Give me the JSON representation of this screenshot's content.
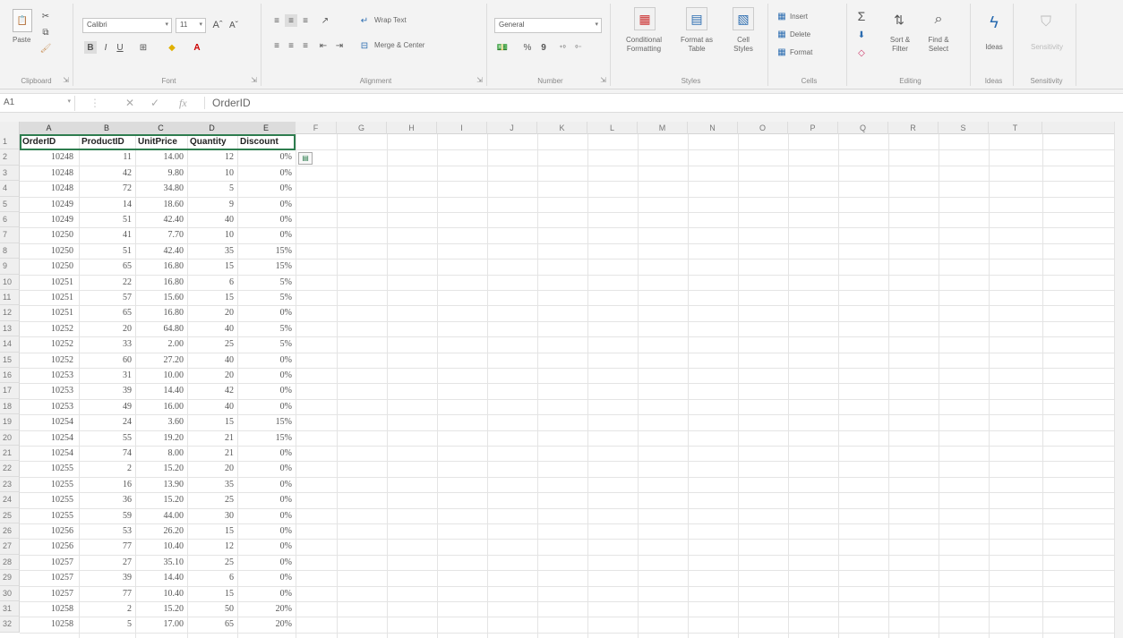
{
  "ribbon": {
    "clipboard": {
      "paste": "Paste",
      "label": "Clipboard"
    },
    "font": {
      "name": "Calibri",
      "size": "11",
      "grow": "Aˆ",
      "shrink": "Aˇ",
      "bold": "B",
      "italic": "I",
      "underline": "U",
      "label": "Font"
    },
    "alignment": {
      "wrap": "Wrap Text",
      "merge": "Merge & Center",
      "label": "Alignment"
    },
    "number": {
      "format": "General",
      "percent": "%",
      "comma": "9",
      "label": "Number"
    },
    "styles": {
      "conditional": "Conditional",
      "conditional2": "Formatting",
      "format_table": "Format as",
      "format_table2": "Table",
      "cell_styles": "Cell",
      "cell_styles2": "Styles",
      "label": "Styles"
    },
    "cells": {
      "insert": "Insert",
      "delete": "Delete",
      "format": "Format",
      "label": "Cells"
    },
    "editing": {
      "sort": "Sort &",
      "sort2": "Filter",
      "find": "Find &",
      "find2": "Select",
      "label": "Editing"
    },
    "ideas": {
      "btn": "Ideas",
      "label": "Ideas"
    },
    "sensitivity": {
      "btn": "Sensitivity",
      "label": "Sensitivity"
    }
  },
  "formula_bar": {
    "name_box": "A1",
    "fx": "fx",
    "content": "OrderID"
  },
  "grid": {
    "columns": [
      "A",
      "B",
      "C",
      "D",
      "E",
      "F",
      "G",
      "H",
      "I",
      "J",
      "K",
      "L",
      "M",
      "N",
      "O",
      "P",
      "Q",
      "R",
      "S",
      "T"
    ],
    "row_numbers": [
      "1",
      "2",
      "3",
      "4",
      "5",
      "6",
      "7",
      "8",
      "9",
      "10",
      "11",
      "12",
      "13",
      "14",
      "15",
      "16",
      "17",
      "18",
      "19",
      "20",
      "21",
      "22",
      "23",
      "24",
      "25",
      "26",
      "27",
      "28",
      "29",
      "30",
      "31",
      "32"
    ],
    "headers": [
      "OrderID",
      "ProductID",
      "UnitPrice",
      "Quantity",
      "Discount"
    ],
    "rows": [
      [
        "10248",
        "11",
        "14.00",
        "12",
        "0%"
      ],
      [
        "10248",
        "42",
        "9.80",
        "10",
        "0%"
      ],
      [
        "10248",
        "72",
        "34.80",
        "5",
        "0%"
      ],
      [
        "10249",
        "14",
        "18.60",
        "9",
        "0%"
      ],
      [
        "10249",
        "51",
        "42.40",
        "40",
        "0%"
      ],
      [
        "10250",
        "41",
        "7.70",
        "10",
        "0%"
      ],
      [
        "10250",
        "51",
        "42.40",
        "35",
        "15%"
      ],
      [
        "10250",
        "65",
        "16.80",
        "15",
        "15%"
      ],
      [
        "10251",
        "22",
        "16.80",
        "6",
        "5%"
      ],
      [
        "10251",
        "57",
        "15.60",
        "15",
        "5%"
      ],
      [
        "10251",
        "65",
        "16.80",
        "20",
        "0%"
      ],
      [
        "10252",
        "20",
        "64.80",
        "40",
        "5%"
      ],
      [
        "10252",
        "33",
        "2.00",
        "25",
        "5%"
      ],
      [
        "10252",
        "60",
        "27.20",
        "40",
        "0%"
      ],
      [
        "10253",
        "31",
        "10.00",
        "20",
        "0%"
      ],
      [
        "10253",
        "39",
        "14.40",
        "42",
        "0%"
      ],
      [
        "10253",
        "49",
        "16.00",
        "40",
        "0%"
      ],
      [
        "10254",
        "24",
        "3.60",
        "15",
        "15%"
      ],
      [
        "10254",
        "55",
        "19.20",
        "21",
        "15%"
      ],
      [
        "10254",
        "74",
        "8.00",
        "21",
        "0%"
      ],
      [
        "10255",
        "2",
        "15.20",
        "20",
        "0%"
      ],
      [
        "10255",
        "16",
        "13.90",
        "35",
        "0%"
      ],
      [
        "10255",
        "36",
        "15.20",
        "25",
        "0%"
      ],
      [
        "10255",
        "59",
        "44.00",
        "30",
        "0%"
      ],
      [
        "10256",
        "53",
        "26.20",
        "15",
        "0%"
      ],
      [
        "10256",
        "77",
        "10.40",
        "12",
        "0%"
      ],
      [
        "10257",
        "27",
        "35.10",
        "25",
        "0%"
      ],
      [
        "10257",
        "39",
        "14.40",
        "6",
        "0%"
      ],
      [
        "10257",
        "77",
        "10.40",
        "15",
        "0%"
      ],
      [
        "10258",
        "2",
        "15.20",
        "50",
        "20%"
      ],
      [
        "10258",
        "5",
        "17.00",
        "65",
        "20%"
      ]
    ]
  }
}
